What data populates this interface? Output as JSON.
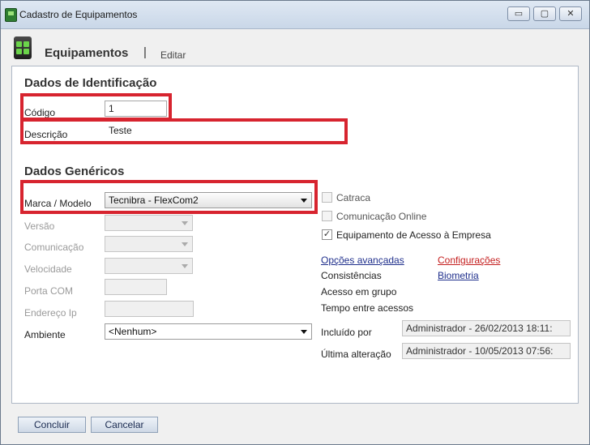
{
  "window": {
    "title": "Cadastro de Equipamentos",
    "minimize": "▭",
    "maximize": "▢",
    "close": "✕"
  },
  "header": {
    "title": "Equipamentos",
    "separator": "|",
    "action": "Editar"
  },
  "identification": {
    "title": "Dados de Identificação",
    "codigo_label": "Código",
    "codigo_value": "1",
    "descricao_label": "Descrição",
    "descricao_value": "Teste"
  },
  "generic": {
    "title": "Dados Genéricos",
    "marca_label": "Marca / Modelo",
    "marca_value": "Tecnibra - FlexCom2",
    "versao_label": "Versão",
    "comunicacao_label": "Comunicação",
    "velocidade_label": "Velocidade",
    "porta_label": "Porta COM",
    "endereco_label": "Endereço Ip",
    "ambiente_label": "Ambiente",
    "ambiente_value": "<Nenhum>"
  },
  "options": {
    "catraca": {
      "label": "Catraca",
      "checked": false
    },
    "comunicacao_online": {
      "label": "Comunicação Online",
      "checked": false
    },
    "acesso_empresa": {
      "label": "Equipamento de Acesso à Empresa",
      "checked": true
    },
    "check_mark": "✓",
    "opcoes_avancadas": "Opções avançadas",
    "configuracoes": "Configurações",
    "consistencias": "Consistências",
    "biometria": "Biometria",
    "acesso_grupo": "Acesso em grupo",
    "tempo_acessos": "Tempo entre acessos",
    "incluido_label": "Incluído por",
    "incluido_value": "Administrador - 26/02/2013 18:11:",
    "alteracao_label": "Última alteração",
    "alteracao_value": "Administrador - 10/05/2013 07:56:"
  },
  "footer": {
    "concluir": "Concluir",
    "cancelar": "Cancelar"
  },
  "colors": {
    "highlight": "#d7242f",
    "link": "#1f2f8c",
    "link_red": "#c41e1e"
  }
}
